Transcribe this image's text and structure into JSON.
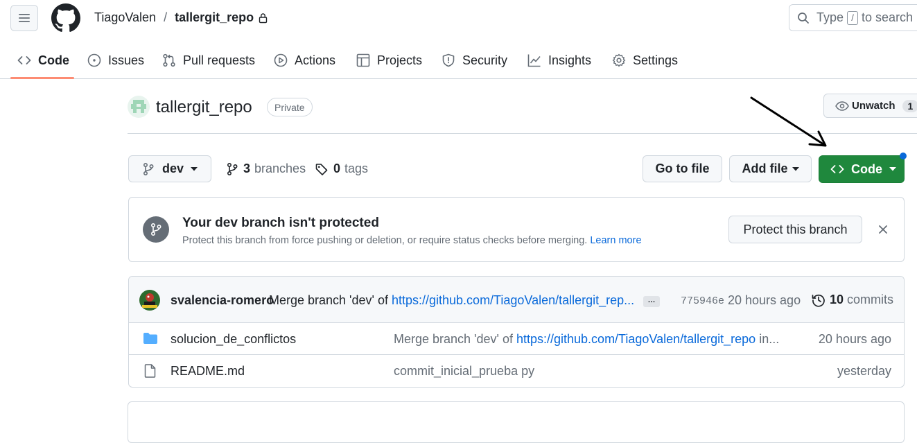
{
  "header": {
    "owner": "TiagoValen",
    "separator": "/",
    "repo": "tallergit_repo",
    "search": {
      "prefix": "Type",
      "key": "/",
      "suffix": "to search"
    }
  },
  "tabs": [
    {
      "label": "Code",
      "icon": "code-icon",
      "selected": true
    },
    {
      "label": "Issues",
      "icon": "issue-icon"
    },
    {
      "label": "Pull requests",
      "icon": "pull-request-icon"
    },
    {
      "label": "Actions",
      "icon": "play-icon"
    },
    {
      "label": "Projects",
      "icon": "table-icon"
    },
    {
      "label": "Security",
      "icon": "shield-icon"
    },
    {
      "label": "Insights",
      "icon": "graph-icon"
    },
    {
      "label": "Settings",
      "icon": "gear-icon"
    }
  ],
  "repo": {
    "name": "tallergit_repo",
    "visibility": "Private",
    "unwatch_label": "Unwatch",
    "watch_count": "1"
  },
  "branch_bar": {
    "current_branch": "dev",
    "branches_count": "3",
    "branches_label": "branches",
    "tags_count": "0",
    "tags_label": "tags",
    "go_to_file": "Go to file",
    "add_file": "Add file",
    "code": "Code"
  },
  "banner": {
    "title": "Your dev branch isn't protected",
    "description": "Protect this branch from force pushing or deletion, or require status checks before merging.",
    "learn_more": "Learn more",
    "action": "Protect this branch"
  },
  "latest_commit": {
    "author": "svalencia-romero",
    "message": "Merge branch 'dev' of",
    "link": "https://github.com/TiagoValen/tallergit_rep...",
    "ellipsis": "…",
    "sha": "775946e",
    "time": "20 hours ago",
    "commits_count": "10",
    "commits_label": "commits"
  },
  "files": [
    {
      "name": "solucion_de_conflictos",
      "type": "folder",
      "message": "Merge branch 'dev' of",
      "message_link": "https://github.com/TiagoValen/tallergit_repo",
      "message_suffix": "in...",
      "time": "20 hours ago"
    },
    {
      "name": "README.md",
      "type": "file",
      "message": "commit_inicial_prueba py",
      "time": "yesterday"
    }
  ],
  "colors": {
    "accent": "#0969da",
    "code_button": "#1f883d",
    "tab_underline": "#fd8c73",
    "border": "#d0d7de",
    "muted_text": "#656d76"
  }
}
